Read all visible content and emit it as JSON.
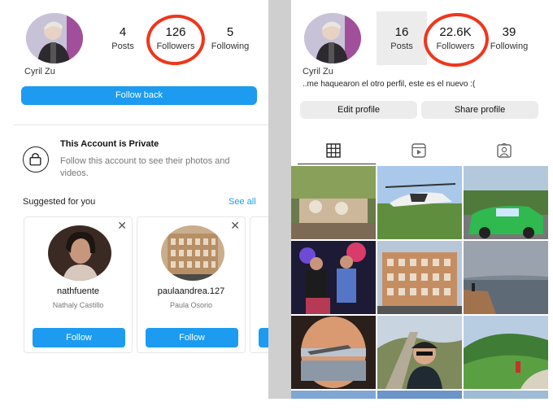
{
  "left": {
    "username": "Cyril Zu",
    "stats": [
      {
        "value": "4",
        "label": "Posts"
      },
      {
        "value": "126",
        "label": "Followers"
      },
      {
        "value": "5",
        "label": "Following"
      }
    ],
    "follow_back_label": "Follow back",
    "private": {
      "title": "This Account is Private",
      "description": "Follow this account to see their photos and videos."
    },
    "suggested": {
      "title": "Suggested for you",
      "see_all": "See all",
      "cards": [
        {
          "username": "nathfuente",
          "name": "Nathaly Castillo",
          "button": "Follow"
        },
        {
          "username": "paulaandrea.127",
          "name": "Paula Osorio",
          "button": "Follow"
        }
      ]
    }
  },
  "right": {
    "username": "Cyril Zu",
    "bio": "..me haquearon el otro perfil, este es el nuevo :(",
    "stats": [
      {
        "value": "16",
        "label": "Posts"
      },
      {
        "value": "22.6K",
        "label": "Followers"
      },
      {
        "value": "39",
        "label": "Following"
      }
    ],
    "edit_profile": "Edit profile",
    "share_profile": "Share profile",
    "tabs": [
      "grid-icon",
      "reels-icon",
      "tagged-icon"
    ]
  },
  "colors": {
    "accent": "#1d9bf0",
    "annotation": "#f0361c",
    "gap": "#cfcfcf"
  }
}
